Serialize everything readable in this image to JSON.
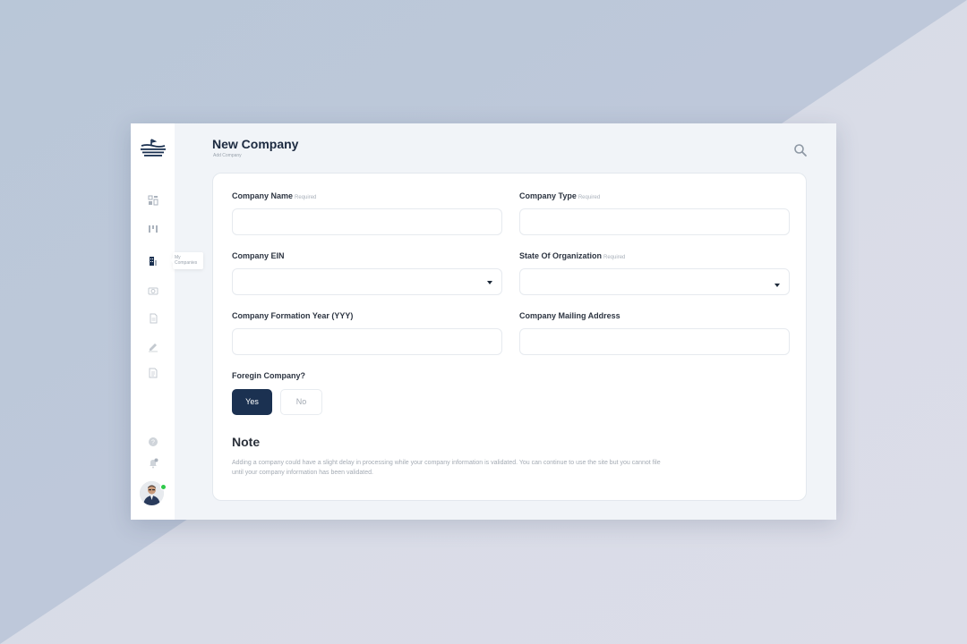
{
  "page": {
    "title": "New Company",
    "subtitle": "Add Company"
  },
  "sidebar": {
    "items": [
      {
        "name": "dashboard",
        "icon": "dashboard-icon"
      },
      {
        "name": "boards",
        "icon": "columns-icon"
      },
      {
        "name": "companies",
        "icon": "building-icon",
        "active": true,
        "tooltip": "My Companies"
      },
      {
        "name": "camera",
        "icon": "camera-icon"
      },
      {
        "name": "documents",
        "icon": "file-icon"
      },
      {
        "name": "signature",
        "icon": "pen-icon"
      },
      {
        "name": "reports",
        "icon": "report-icon"
      }
    ],
    "tooltip_line1": "My",
    "tooltip_line2": "Companies"
  },
  "form": {
    "company_name": {
      "label": "Company Name",
      "required": "Required",
      "value": ""
    },
    "company_type": {
      "label": "Company Type",
      "required": "Required",
      "value": ""
    },
    "company_ein": {
      "label": "Company EIN",
      "value": ""
    },
    "state_of_organization": {
      "label": "State Of Organization",
      "required": "Required",
      "value": ""
    },
    "formation_year": {
      "label": "Company Formation Year (YYY)",
      "value": ""
    },
    "mailing_address": {
      "label": "Company Mailing Address",
      "value": ""
    },
    "foreign_company": {
      "label": "Foregin Company?",
      "yes_label": "Yes",
      "no_label": "No",
      "selected": "Yes"
    }
  },
  "note": {
    "title": "Note",
    "line1": "Adding a company could have a slight delay in processing while your company information is validated. You can continue to use the site but you cannot file",
    "line2": "until your company information has been validated."
  },
  "colors": {
    "primary": "#1b3151",
    "online": "#2ec94a",
    "page_bg": "#f1f4f8"
  }
}
